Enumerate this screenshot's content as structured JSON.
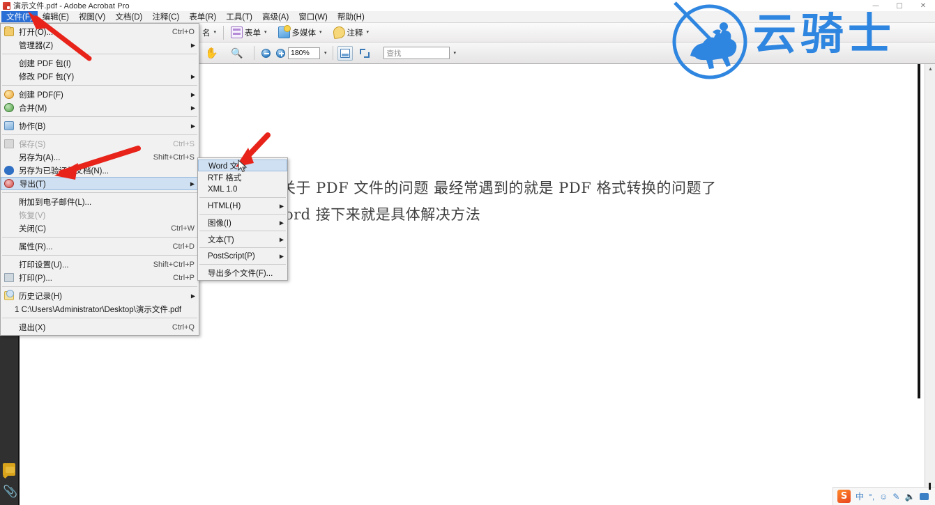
{
  "window": {
    "title": "演示文件.pdf - Adobe Acrobat Pro",
    "app_icon": "pdf-document-icon",
    "controls": {
      "minimize": "—",
      "restore": "□",
      "close": "✕"
    }
  },
  "menubar": {
    "items": [
      {
        "label": "文件(F)",
        "active": true
      },
      {
        "label": "编辑(E)",
        "active": false
      },
      {
        "label": "视图(V)",
        "active": false
      },
      {
        "label": "文档(D)",
        "active": false
      },
      {
        "label": "注释(C)",
        "active": false
      },
      {
        "label": "表单(R)",
        "active": false
      },
      {
        "label": "工具(T)",
        "active": false
      },
      {
        "label": "高级(A)",
        "active": false
      },
      {
        "label": "窗口(W)",
        "active": false
      },
      {
        "label": "帮助(H)",
        "active": false
      }
    ]
  },
  "toolbar_top": {
    "sign_label": "名",
    "form_label": "表单",
    "media_label": "多媒体",
    "comment_label": "注释",
    "caret": "▾"
  },
  "toolbar_main": {
    "hand_icon": "hand-tool-icon",
    "select_icon": "marquee-zoom-icon",
    "zoom_out_icon": "zoom-out-icon",
    "zoom_in_icon": "zoom-in-icon",
    "zoom_value": "180%",
    "zoom_caret": "▾",
    "fit_page_icon": "fit-page-icon",
    "fit_width_icon": "fit-width-icon",
    "find_placeholder": "查找",
    "find_value": "",
    "find_caret": "▾"
  },
  "file_menu": {
    "items": [
      {
        "label": "打开(O)...",
        "shortcut": "Ctrl+O",
        "icon": "folder-open-icon",
        "submenu": false,
        "disabled": false
      },
      {
        "label": "管理器(Z)",
        "shortcut": "",
        "icon": "",
        "submenu": true,
        "disabled": false
      },
      {
        "sep": true
      },
      {
        "label": "创建 PDF 包(I)",
        "shortcut": "",
        "icon": "",
        "submenu": false,
        "disabled": false
      },
      {
        "label": "修改 PDF 包(Y)",
        "shortcut": "",
        "icon": "",
        "submenu": true,
        "disabled": false
      },
      {
        "sep": true
      },
      {
        "label": "创建 PDF(F)",
        "shortcut": "",
        "icon": "create-pdf-icon",
        "submenu": true,
        "disabled": false
      },
      {
        "label": "合并(M)",
        "shortcut": "",
        "icon": "merge-icon",
        "submenu": true,
        "disabled": false
      },
      {
        "sep": true
      },
      {
        "label": "协作(B)",
        "shortcut": "",
        "icon": "collaborate-icon",
        "submenu": true,
        "disabled": false
      },
      {
        "sep": true
      },
      {
        "label": "保存(S)",
        "shortcut": "Ctrl+S",
        "icon": "save-icon",
        "submenu": false,
        "disabled": true
      },
      {
        "label": "另存为(A)...",
        "shortcut": "Shift+Ctrl+S",
        "icon": "",
        "submenu": false,
        "disabled": false
      },
      {
        "label": "另存为已验证的文档(N)...",
        "shortcut": "",
        "icon": "certified-icon",
        "submenu": false,
        "disabled": false
      },
      {
        "label": "导出(T)",
        "shortcut": "",
        "icon": "export-icon",
        "submenu": true,
        "disabled": false,
        "highlighted": true
      },
      {
        "sep": true
      },
      {
        "label": "附加到电子邮件(L)...",
        "shortcut": "",
        "icon": "",
        "submenu": false,
        "disabled": false
      },
      {
        "label": "恢复(V)",
        "shortcut": "",
        "icon": "",
        "submenu": false,
        "disabled": true
      },
      {
        "label": "关闭(C)",
        "shortcut": "Ctrl+W",
        "icon": "",
        "submenu": false,
        "disabled": false
      },
      {
        "sep": true
      },
      {
        "label": "属性(R)...",
        "shortcut": "Ctrl+D",
        "icon": "",
        "submenu": false,
        "disabled": false
      },
      {
        "sep": true
      },
      {
        "label": "打印设置(U)...",
        "shortcut": "Shift+Ctrl+P",
        "icon": "",
        "submenu": false,
        "disabled": false
      },
      {
        "label": "打印(P)...",
        "shortcut": "Ctrl+P",
        "icon": "print-icon",
        "submenu": false,
        "disabled": false
      },
      {
        "sep": true
      },
      {
        "label": "历史记录(H)",
        "shortcut": "",
        "icon": "history-icon",
        "submenu": true,
        "disabled": false
      },
      {
        "label": "1 C:\\Users\\Administrator\\Desktop\\演示文件.pdf",
        "shortcut": "",
        "icon": "",
        "submenu": false,
        "disabled": false
      },
      {
        "sep": true
      },
      {
        "label": "退出(X)",
        "shortcut": "Ctrl+Q",
        "icon": "",
        "submenu": false,
        "disabled": false
      }
    ]
  },
  "export_submenu": {
    "items": [
      {
        "label": "Word 文档",
        "submenu": false,
        "highlighted": true
      },
      {
        "label": "RTF 格式",
        "submenu": false
      },
      {
        "label": "XML 1.0",
        "submenu": false
      },
      {
        "sep": true
      },
      {
        "label": "HTML(H)",
        "submenu": true
      },
      {
        "sep": true
      },
      {
        "label": "图像(I)",
        "submenu": true
      },
      {
        "sep": true
      },
      {
        "label": "文本(T)",
        "submenu": true
      },
      {
        "sep": true
      },
      {
        "label": "PostScript(P)",
        "submenu": true
      },
      {
        "sep": true
      },
      {
        "label": "导出多个文件(F)...",
        "submenu": false
      }
    ]
  },
  "document": {
    "line1": "各种关于 PDF 文件的问题   最经常遇到的就是 PDF 格式转换的问题了",
    "line2": "ord   接下来就是具体解决方法"
  },
  "watermark": {
    "text": "云骑士",
    "emblem": "knight-on-horse-emblem",
    "color": "#2f86e0"
  },
  "nav_pane": {
    "comments_icon": "sticky-note-icon",
    "attachments_icon": "paperclip-icon"
  },
  "scrollbar": {
    "up_arrow": "▲",
    "down_arrow": "▼"
  },
  "ime_bar": {
    "logo": "S",
    "mode": "中",
    "punctuation": "°,",
    "emoji": "☺",
    "pen": "✎",
    "mic": "🎤",
    "keyboard": "keyboard-icon"
  },
  "annotations": {
    "arrow1_target": "文件(F) menu",
    "arrow2_target": "导出(T) menu item",
    "arrow3_target": "Word 文档 submenu item"
  },
  "colors": {
    "menu_highlight": "#2a6fd6",
    "item_highlight": "#cfe0f2",
    "arrow_red": "#e8231a",
    "watermark_blue": "#2f86e0",
    "navpane_dark": "#303030"
  }
}
